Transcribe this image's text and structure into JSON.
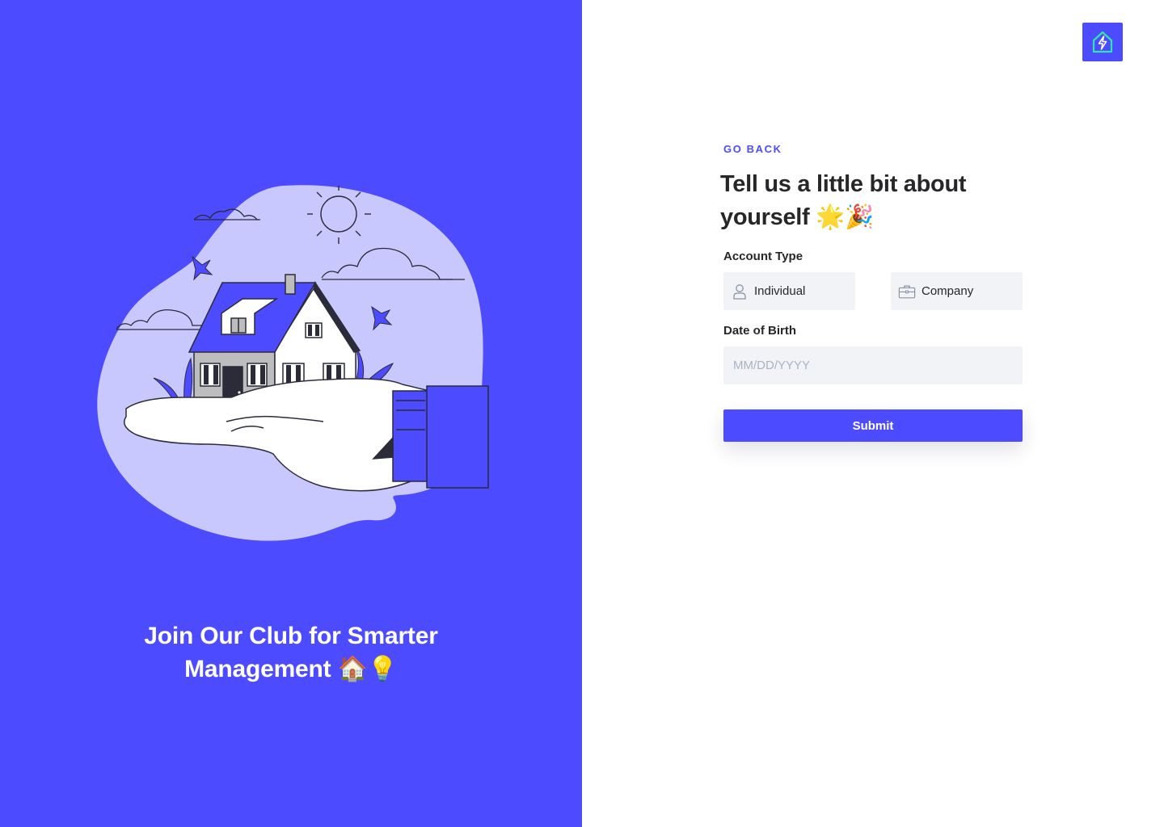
{
  "hero": {
    "tagline_line1": "Join Our Club for Smarter",
    "tagline_line2": "Management",
    "tagline_emoji": "🏠💡",
    "illustration_icon": "hand-holding-house-illustration"
  },
  "header": {
    "logo_icon": "house-lightning-logo-icon"
  },
  "form": {
    "go_back_label": "GO BACK",
    "title": "Tell us a little bit about yourself",
    "title_emoji": "🌟🎉",
    "account_type_label": "Account Type",
    "account_options": [
      {
        "label": "Individual",
        "icon": "person-icon"
      },
      {
        "label": "Company",
        "icon": "briefcase-icon"
      }
    ],
    "dob_label": "Date of Birth",
    "dob_placeholder": "MM/DD/YYYY",
    "dob_value": "",
    "submit_label": "Submit"
  },
  "colors": {
    "brand": "#4D4BFF",
    "blob": "#C8C8FF",
    "text": "#27272A",
    "input_bg": "#F1F3F6",
    "placeholder": "#A9B3C2",
    "logo_accent": "#2EE6A6"
  }
}
